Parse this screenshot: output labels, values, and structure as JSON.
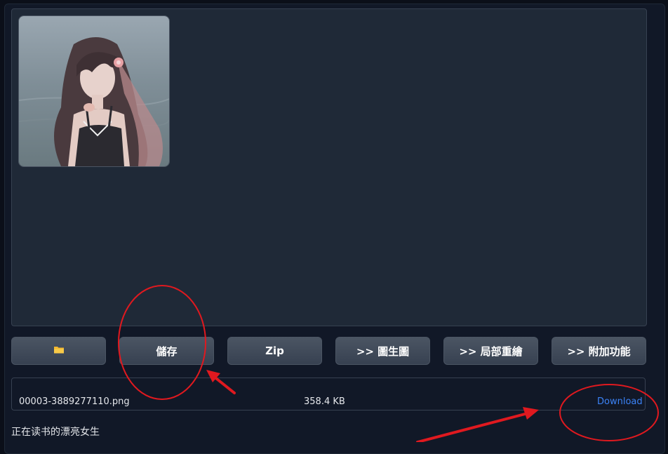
{
  "buttons": {
    "folder_icon": "folder-icon",
    "save_label": "儲存",
    "zip_label": "Zip",
    "img2img_label": ">> 圖生圖",
    "inpaint_label": ">> 局部重繪",
    "extras_label": ">> 附加功能"
  },
  "file": {
    "name": "00003-3889277110.png",
    "size": "358.4 KB",
    "download_label": "Download"
  },
  "caption": "正在读书的漂亮女生",
  "colors": {
    "accent_link": "#3b82f6",
    "annotation": "#e0191f",
    "folder": "#f5b82e"
  }
}
